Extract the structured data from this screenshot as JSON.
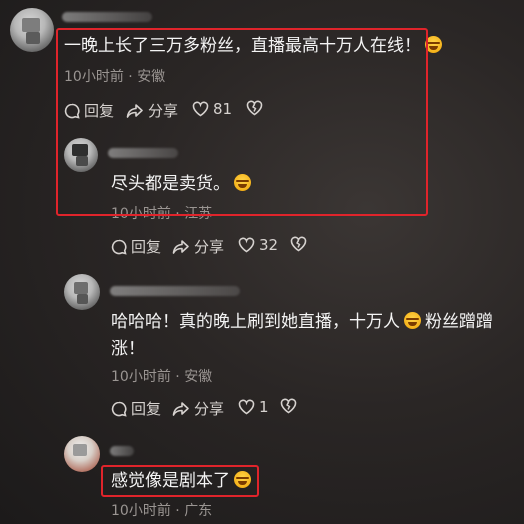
{
  "comments": [
    {
      "text": "一晚上长了三万多粉丝，直播最高十万人在线！",
      "time": "10小时前",
      "location": "安徽",
      "reply_label": "回复",
      "share_label": "分享",
      "like_count": "81",
      "reply": {
        "text": "尽头都是卖货。",
        "time": "10小时前",
        "location": "江苏",
        "reply_label": "回复",
        "share_label": "分享",
        "like_count": "32"
      }
    },
    {
      "text_line1_a": "哈哈哈！真的晚上刷到她直播，十万人",
      "text_line1_b": "粉丝蹭蹭",
      "text_line2": "涨！",
      "time": "10小时前",
      "location": "安徽",
      "reply_label": "回复",
      "share_label": "分享",
      "like_count": "1"
    },
    {
      "text": "感觉像是剧本了",
      "time": "10小时前",
      "location": "广东"
    }
  ],
  "separator": "·",
  "colors": {
    "highlight": "#e0242b",
    "background": "#2a2625",
    "meta": "#9a9592"
  },
  "icons": [
    "comment-bubble-icon",
    "share-arrow-icon",
    "heart-icon",
    "broken-heart-icon",
    "laughing-emoji-icon",
    "crying-emoji-icon"
  ]
}
